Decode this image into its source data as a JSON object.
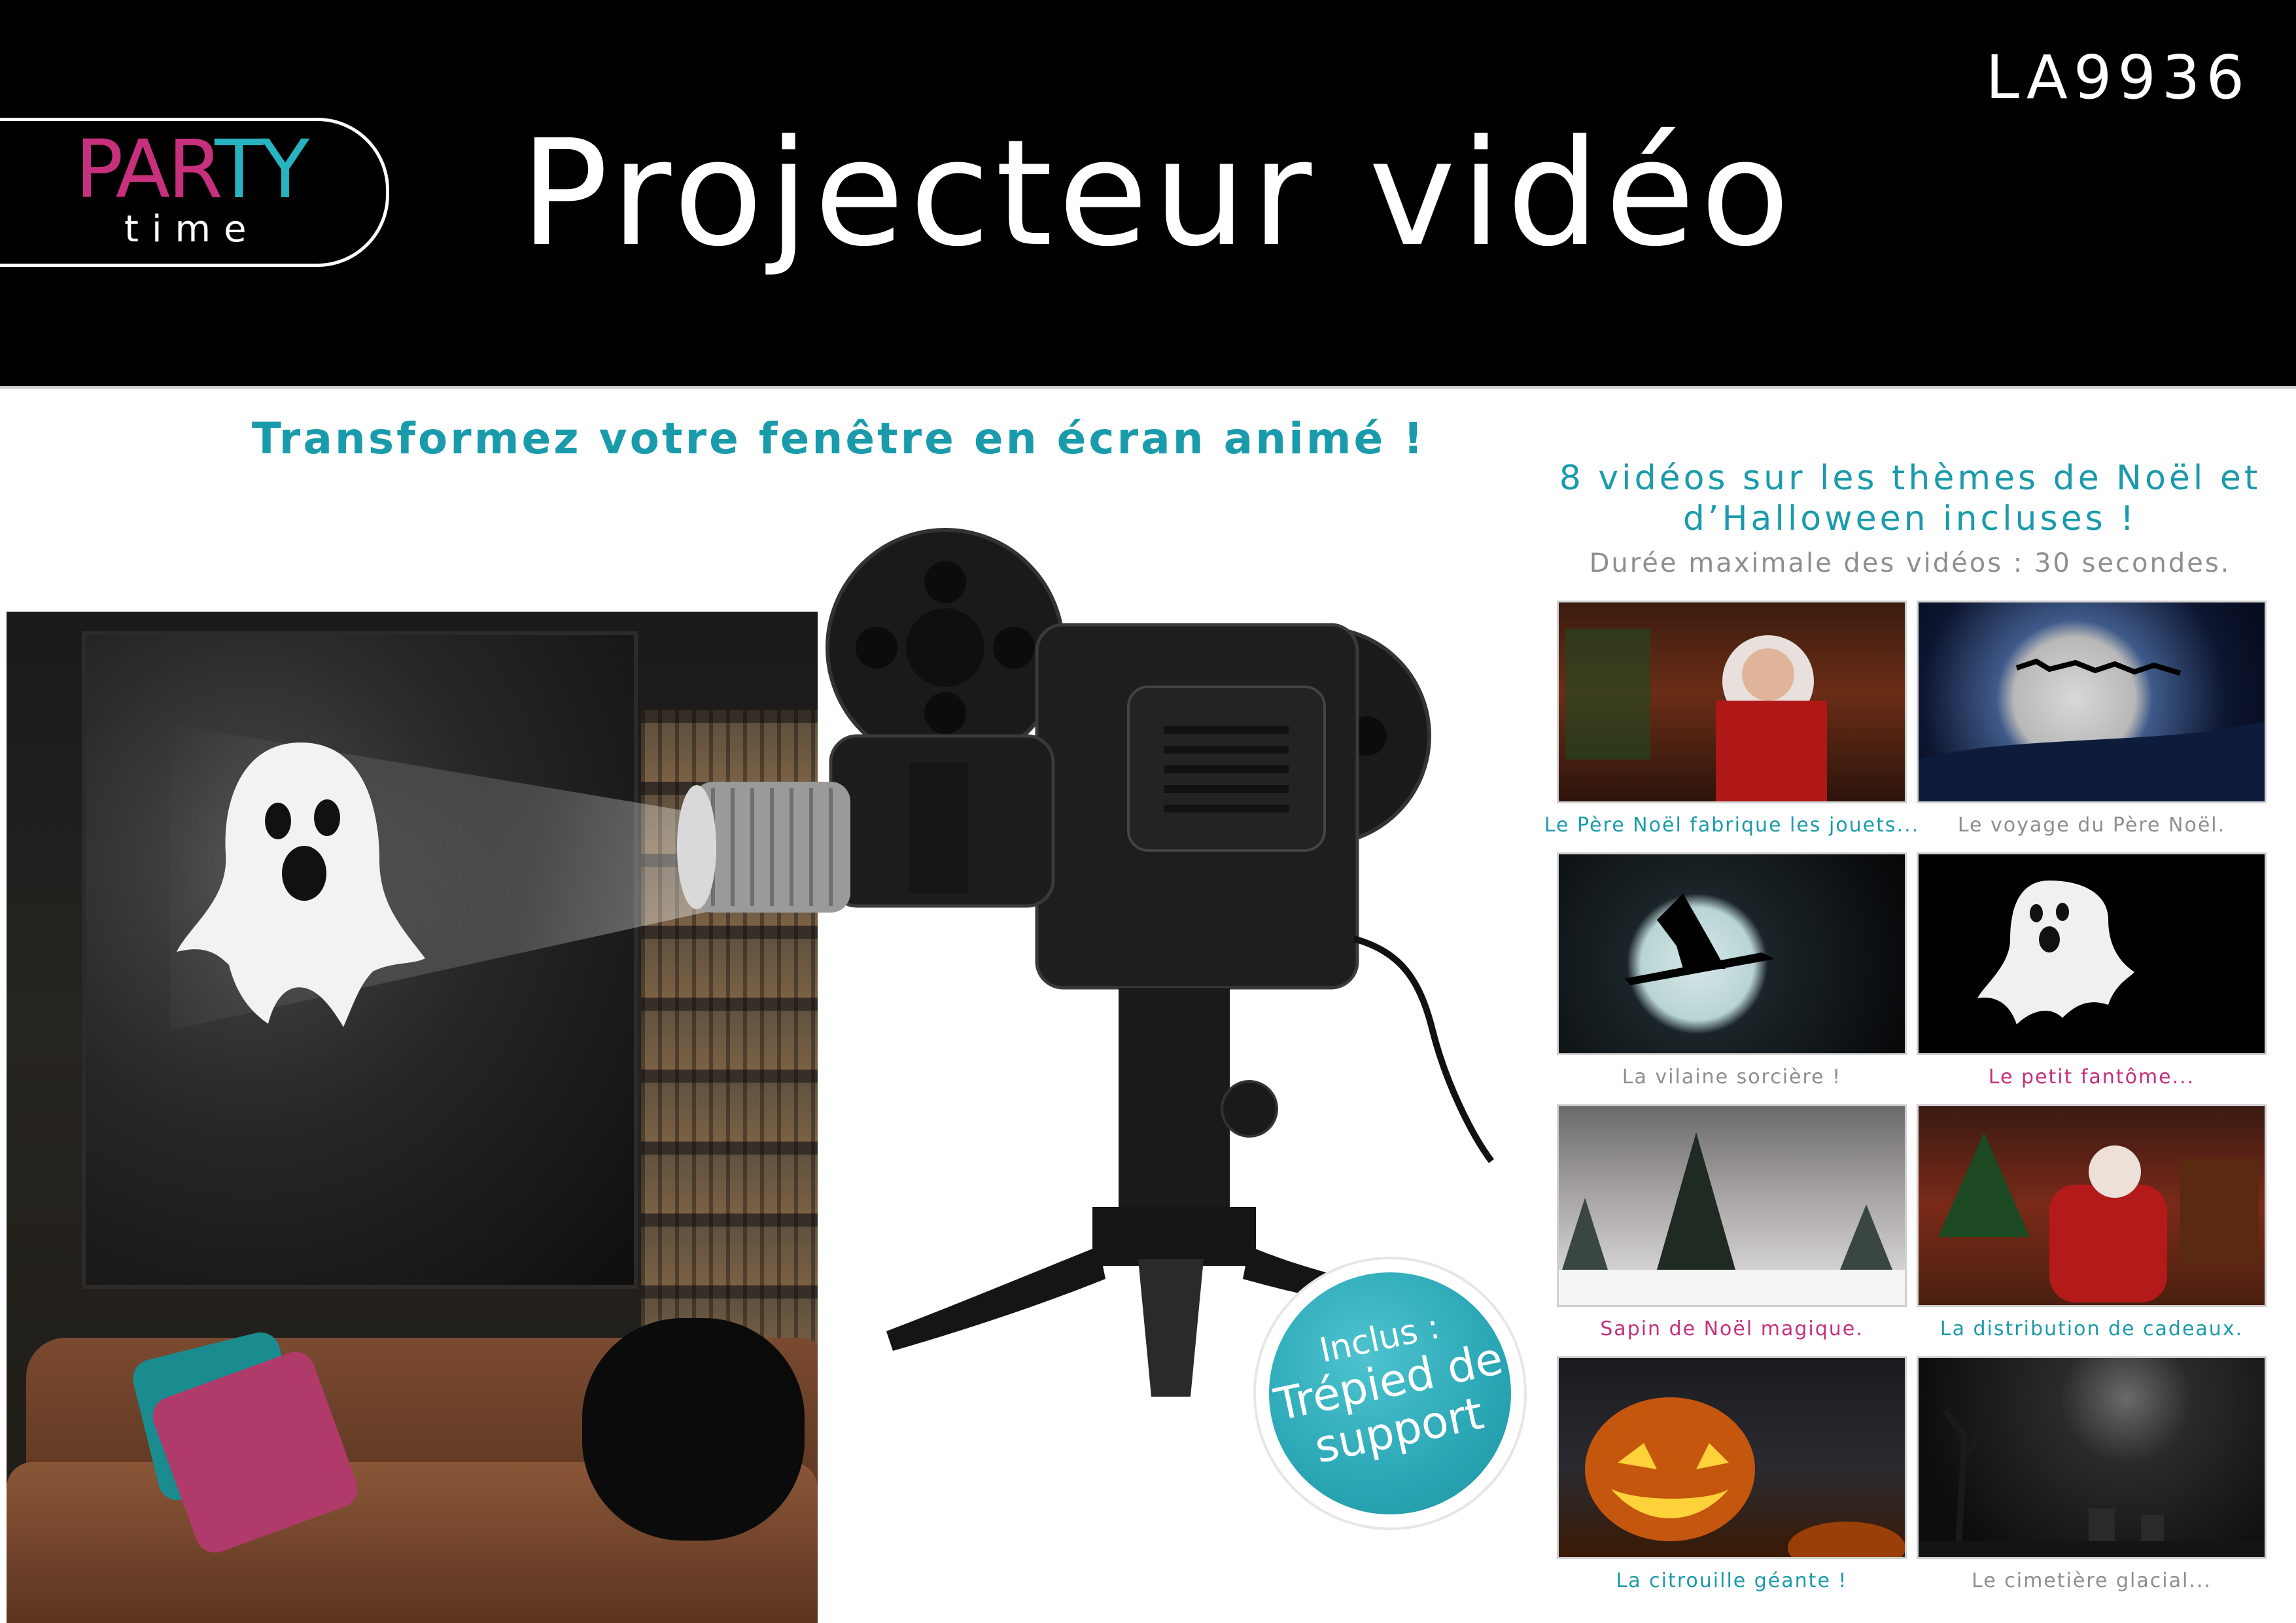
{
  "brand": {
    "party_part1": "PAR",
    "party_part2": "TY",
    "time": "time"
  },
  "product_code": "LA9936",
  "title": "Projecteur vidéo",
  "tagline": "Transformez votre fenêtre en écran animé !",
  "videos_heading": "8 vidéos sur les thèmes de Noël et d’Halloween incluses !",
  "duration_note": "Durée maximale des vidéos : 30 secondes.",
  "badge": {
    "line1": "Inclus :",
    "line2": "Trépied de",
    "line3": "support"
  },
  "colors": {
    "teal": "#1a9bab",
    "magenta": "#c6307c",
    "gray": "#8e8e8e",
    "black": "#000000"
  },
  "videos": [
    {
      "caption": "Le Père Noël fabrique les jouets...",
      "color": "#1a9bab",
      "thumb": "santa-workshop"
    },
    {
      "caption": "Le voyage du Père Noël.",
      "color": "#8e8e8e",
      "thumb": "sleigh-moon"
    },
    {
      "caption": "La vilaine sorcière !",
      "color": "#8e8e8e",
      "thumb": "witch-moon"
    },
    {
      "caption": "Le petit fantôme...",
      "color": "#c6307c",
      "thumb": "ghost"
    },
    {
      "caption": "Sapin de Noël magique.",
      "color": "#c6307c",
      "thumb": "snowy-tree"
    },
    {
      "caption": "La distribution de cadeaux.",
      "color": "#1a9bab",
      "thumb": "santa-gifts"
    },
    {
      "caption": "La citrouille géante !",
      "color": "#1a9bab",
      "thumb": "jack-o-lantern"
    },
    {
      "caption": "Le cimetière glacial...",
      "color": "#8e8e8e",
      "thumb": "cemetery"
    }
  ]
}
